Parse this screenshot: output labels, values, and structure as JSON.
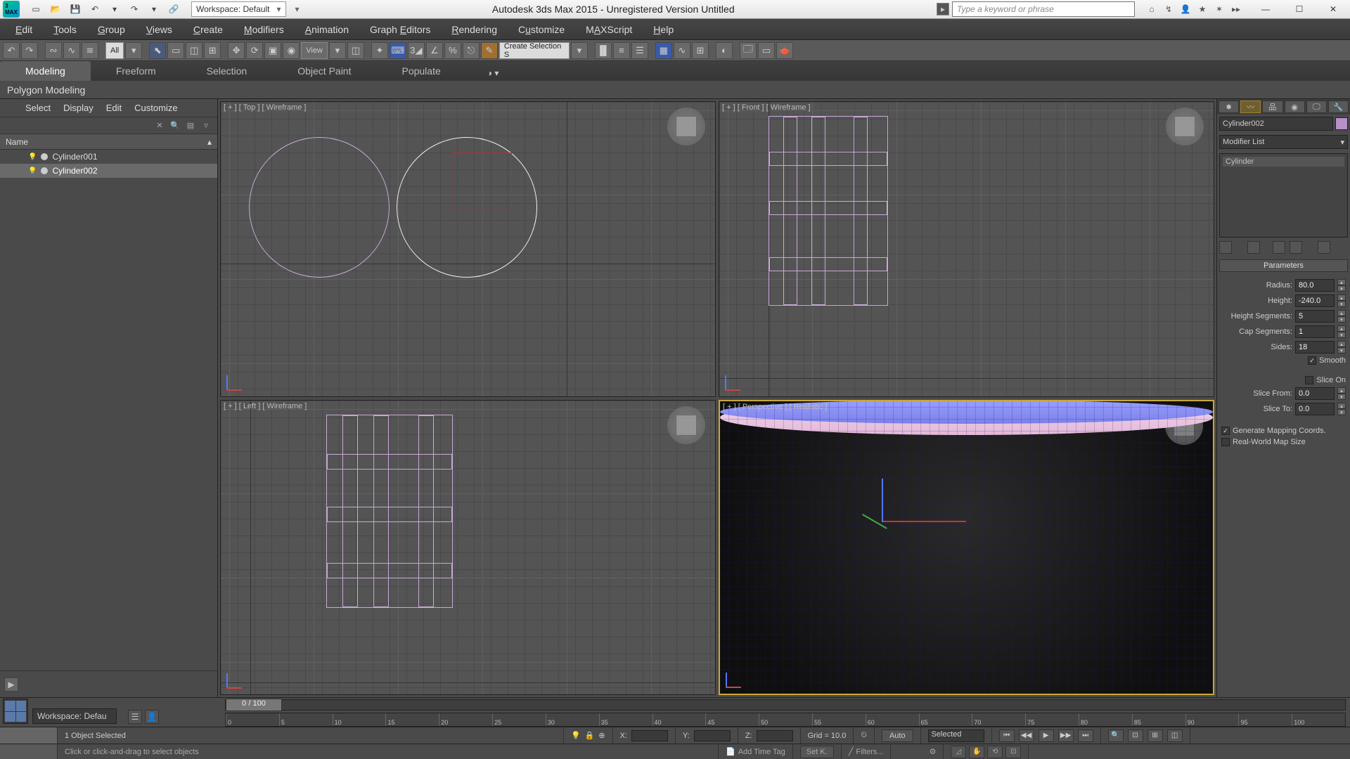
{
  "title": "Autodesk 3ds Max  2015  - Unregistered Version    Untitled",
  "workspace_selector": "Workspace: Default",
  "search_placeholder": "Type a keyword or phrase",
  "menus": [
    "Edit",
    "Tools",
    "Group",
    "Views",
    "Create",
    "Modifiers",
    "Animation",
    "Graph Editors",
    "Rendering",
    "Customize",
    "MAXScript",
    "Help"
  ],
  "menus_underline_idx": [
    0,
    0,
    0,
    0,
    0,
    0,
    0,
    0,
    0,
    1,
    0,
    0
  ],
  "toolbar_filter": "All",
  "toolbar_view": "View",
  "toolbar_selset": "Create Selection S",
  "ribbon_tabs": [
    "Modeling",
    "Freeform",
    "Selection",
    "Object Paint",
    "Populate"
  ],
  "ribbon_active": 0,
  "subribbon": "Polygon Modeling",
  "scene_menu": [
    "Select",
    "Display",
    "Edit",
    "Customize"
  ],
  "scene_header": "Name",
  "scene_items": [
    {
      "name": "Cylinder001",
      "selected": false
    },
    {
      "name": "Cylinder002",
      "selected": true
    }
  ],
  "workspace_footer": "Workspace: Defau",
  "viewports": {
    "tl": "[ + ] [ Top ] [ Wireframe ]",
    "tr": "[ + ] [ Front ] [ Wireframe ]",
    "bl": "[ + ] [ Left ] [ Wireframe ]",
    "br": "[ + ] [ Perspective ] [ Realistic ]"
  },
  "cmd": {
    "object_name": "Cylinder002",
    "modifier_list": "Modifier List",
    "stack_item": "Cylinder",
    "rollout": "Parameters",
    "params": {
      "Radius": "80.0",
      "Height": "-240.0",
      "Height Segments": "5",
      "Cap Segments": "1",
      "Sides": "18"
    },
    "smooth": true,
    "slice_on": false,
    "slice_from": "0.0",
    "slice_to": "0.0",
    "gen_mapping": true,
    "realworld": false,
    "labels": {
      "radius": "Radius:",
      "height": "Height:",
      "hseg": "Height Segments:",
      "cseg": "Cap Segments:",
      "sides": "Sides:",
      "smooth": "Smooth",
      "sliceon": "Slice On",
      "slicefrom": "Slice From:",
      "sliceto": "Slice To:",
      "genmap": "Generate Mapping Coords.",
      "realworld": "Real-World Map Size"
    }
  },
  "timeline": {
    "thumb": "0 / 100",
    "ticks": [
      "0",
      "5",
      "10",
      "15",
      "20",
      "25",
      "30",
      "35",
      "40",
      "45",
      "50",
      "55",
      "60",
      "65",
      "70",
      "75",
      "80",
      "85",
      "90",
      "95",
      "100"
    ]
  },
  "status": {
    "selection": "1 Object Selected",
    "prompt": "Click or click-and-drag to select objects",
    "x": "X:",
    "y": "Y:",
    "z": "Z:",
    "grid": "Grid = 10.0",
    "autokey": "Auto",
    "setkey": "Set K.",
    "selected_filter": "Selected",
    "filters": "Filters...",
    "addtag": "Add Time Tag"
  }
}
